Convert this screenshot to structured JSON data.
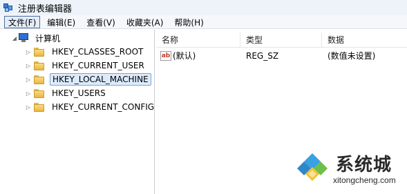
{
  "window": {
    "title": "注册表编辑器"
  },
  "menu": {
    "items": [
      "文件(F)",
      "编辑(E)",
      "查看(V)",
      "收藏夹(A)",
      "帮助(H)"
    ]
  },
  "tree": {
    "root": "计算机",
    "items": [
      "HKEY_CLASSES_ROOT",
      "HKEY_CURRENT_USER",
      "HKEY_LOCAL_MACHINE",
      "HKEY_USERS",
      "HKEY_CURRENT_CONFIG"
    ],
    "selected": "HKEY_LOCAL_MACHINE"
  },
  "list": {
    "columns": [
      "名称",
      "类型",
      "数据"
    ],
    "rows": [
      {
        "name": "(默认)",
        "type": "REG_SZ",
        "data": "(数值未设置)"
      }
    ]
  },
  "watermark": {
    "brand": "系统城",
    "url": "xitongcheng.com"
  }
}
